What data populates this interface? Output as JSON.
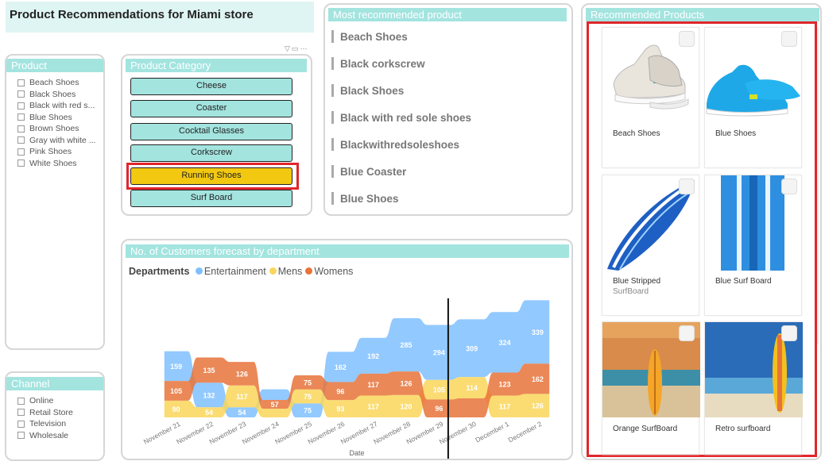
{
  "title": "Product Recommendations for Miami store",
  "product_slicer": {
    "header": "Product",
    "items": [
      "Beach Shoes",
      "Black Shoes",
      "Black with red s...",
      "Blue Shoes",
      "Brown Shoes",
      "Gray with white ...",
      "Pink Shoes",
      "White Shoes"
    ]
  },
  "channel_slicer": {
    "header": "Channel",
    "items": [
      "Online",
      "Retail Store",
      "Television",
      "Wholesale"
    ]
  },
  "category_slicer": {
    "header": "Product Category",
    "items": [
      "Cheese",
      "Coaster",
      "Cocktail Glasses",
      "Corkscrew",
      "Running Shoes",
      "Surf Board"
    ],
    "selected": "Running Shoes"
  },
  "most_recommended": {
    "header": "Most recommended product",
    "items": [
      "Beach Shoes",
      "Black corkscrew",
      "Black Shoes",
      "Black with red sole shoes",
      "Blackwithredsoleshoes",
      "Blue Coaster",
      "Blue Shoes"
    ]
  },
  "recommended_products": {
    "header": "Recommended Products",
    "cards": [
      {
        "label": "Beach Shoes",
        "sub": ""
      },
      {
        "label": "Blue Shoes",
        "sub": ""
      },
      {
        "label": "Blue Stripped",
        "sub": "SurfBoard"
      },
      {
        "label": "Blue Surf Board",
        "sub": ""
      },
      {
        "label": "Orange SurfBoard",
        "sub": ""
      },
      {
        "label": "Retro surfboard",
        "sub": ""
      }
    ]
  },
  "forecast": {
    "header": "No. of Customers forecast by department",
    "legend_title": "Departments",
    "x_axis_title": "Date",
    "tick_labels": [
      "November 21",
      "November 22",
      "November 23",
      "November 24",
      "November 25",
      "November 26",
      "November 27",
      "November 28",
      "November 29",
      "November 30",
      "December 1",
      "December 2"
    ],
    "colors": {
      "Entertainment": "#7fbfff",
      "Mens": "#f9d65a",
      "Womens": "#e8733a"
    }
  },
  "chart_data": {
    "type": "area",
    "title": "No. of Customers forecast by department",
    "xlabel": "Date",
    "ylabel": "",
    "legend": "top-left",
    "x": [
      "November 21",
      "November 22",
      "November 23",
      "November 24",
      "November 25",
      "November 26",
      "November 27",
      "November 28",
      "November 29",
      "November 30",
      "December 1",
      "December 2"
    ],
    "series": [
      {
        "name": "Entertainment",
        "values": [
          159,
          132,
          54,
          57,
          75,
          162,
          192,
          285,
          294,
          309,
          324,
          339
        ]
      },
      {
        "name": "Mens",
        "values": [
          90,
          54,
          117,
          40,
          75,
          93,
          117,
          120,
          105,
          114,
          117,
          126
        ]
      },
      {
        "name": "Womens",
        "values": [
          105,
          135,
          126,
          40,
          75,
          96,
          117,
          126,
          96,
          102,
          123,
          162
        ]
      }
    ],
    "labels_shown": {
      "Entertainment": [
        "159",
        "132",
        "54",
        "",
        "75",
        "162",
        "192",
        "285",
        "294",
        "309",
        "324",
        "339"
      ],
      "Mens": [
        "90",
        "54",
        "117",
        "",
        "75",
        "93",
        "117",
        "120",
        "105",
        "114",
        "117",
        "126"
      ],
      "Womens": [
        "105",
        "135",
        "126",
        "57",
        "75",
        "96",
        "117",
        "126",
        "96",
        "",
        "123",
        "162"
      ]
    }
  }
}
